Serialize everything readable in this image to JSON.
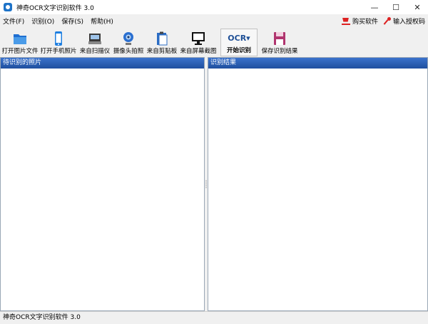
{
  "window": {
    "title": "神奇OCR文字识别软件 3.0",
    "controls": {
      "minimize": "—",
      "maximize": "☐",
      "close": "✕"
    }
  },
  "menu": {
    "items": [
      "文件(F)",
      "识别(O)",
      "保存(S)",
      "帮助(H)"
    ],
    "buy_label": "购买软件",
    "license_label": "输入授权码"
  },
  "toolbar": {
    "buttons": [
      {
        "label": "打开图片文件",
        "icon": "folder-icon"
      },
      {
        "label": "打开手机照片",
        "icon": "phone-icon"
      },
      {
        "label": "来自扫描仪",
        "icon": "scanner-icon"
      },
      {
        "label": "摄像头拍照",
        "icon": "webcam-icon"
      },
      {
        "label": "来自剪贴板",
        "icon": "clipboard-icon"
      },
      {
        "label": "来自屏幕截图",
        "icon": "monitor-icon"
      },
      {
        "label": "开始识别",
        "icon": "ocr-icon",
        "logo": "OCR▾"
      },
      {
        "label": "保存识别结果",
        "icon": "save-icon"
      }
    ]
  },
  "panes": {
    "left_title": "待识别的照片",
    "right_title": "识别结果"
  },
  "status": {
    "text": "神奇OCR文字识别软件 3.0"
  },
  "colors": {
    "header_blue": "#2a5db0",
    "accent_red": "#dd2222"
  }
}
